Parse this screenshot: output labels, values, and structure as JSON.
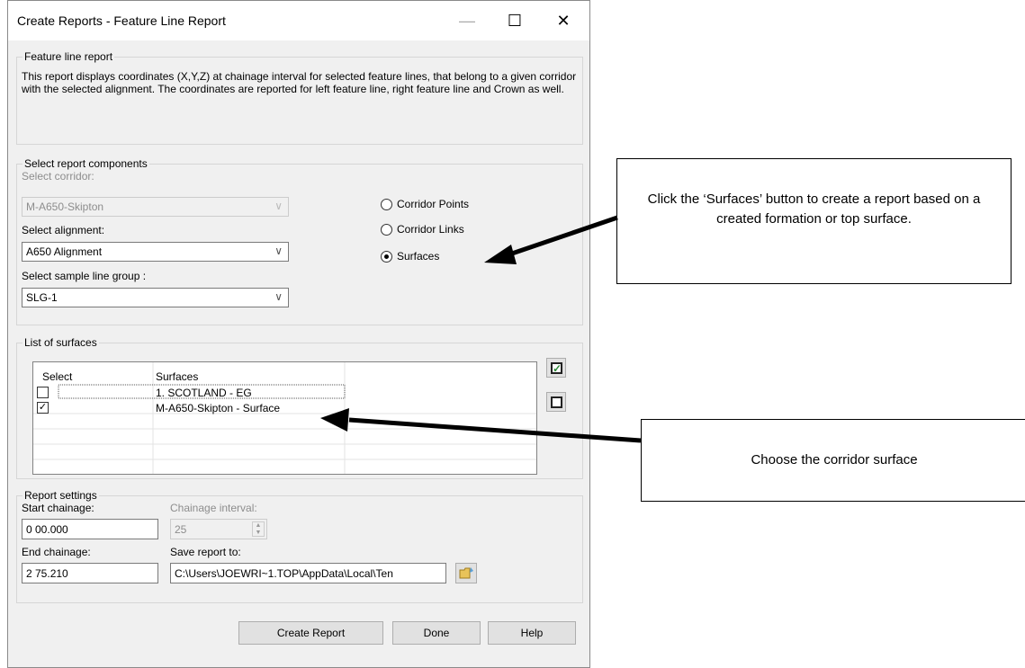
{
  "window": {
    "title": "Create Reports - Feature Line Report",
    "minimize": "—",
    "maximize": "☐",
    "close": "✕"
  },
  "feature_line_report": {
    "legend": "Feature line report",
    "description": "This report displays coordinates (X,Y,Z) at chainage interval for selected feature lines, that belong to a given corridor with the selected alignment. The coordinates are reported for left feature line, right feature line and Crown as well."
  },
  "report_components": {
    "legend": "Select report components",
    "corridor_label": "Select corridor:",
    "corridor_value": "M-A650-Skipton",
    "alignment_label": "Select alignment:",
    "alignment_value": "A650 Alignment",
    "sample_line_label": "Select sample line group :",
    "sample_line_value": "SLG-1",
    "radios": [
      {
        "label": "Corridor Points",
        "selected": false
      },
      {
        "label": "Corridor Links",
        "selected": false
      },
      {
        "label": "Surfaces",
        "selected": true
      }
    ]
  },
  "surfaces": {
    "legend": "List of surfaces",
    "columns": [
      "Select",
      "Surfaces"
    ],
    "rows": [
      {
        "checked": false,
        "name": "1. SCOTLAND - EG"
      },
      {
        "checked": true,
        "name": "M-A650-Skipton - Surface"
      }
    ],
    "check_mark": "✓"
  },
  "report_settings": {
    "legend": "Report settings",
    "start_label": "Start chainage:",
    "start_value": "0 00.000",
    "interval_label": "Chainage interval:",
    "interval_value": "25",
    "end_label": "End chainage:",
    "end_value": "2 75.210",
    "save_label": "Save report to:",
    "save_value": "C:\\Users\\JOEWRI~1.TOP\\AppData\\Local\\Ten"
  },
  "buttons": {
    "create": "Create Report",
    "done": "Done",
    "help": "Help"
  },
  "callouts": {
    "surfaces_note": "Click the ‘Surfaces’ button to create a report based on a created formation or top surface.",
    "corridor_note": "Choose the corridor surface"
  },
  "colors": {
    "check_green": "#2e8b3a",
    "dialog_bg": "#f0f0f0"
  }
}
